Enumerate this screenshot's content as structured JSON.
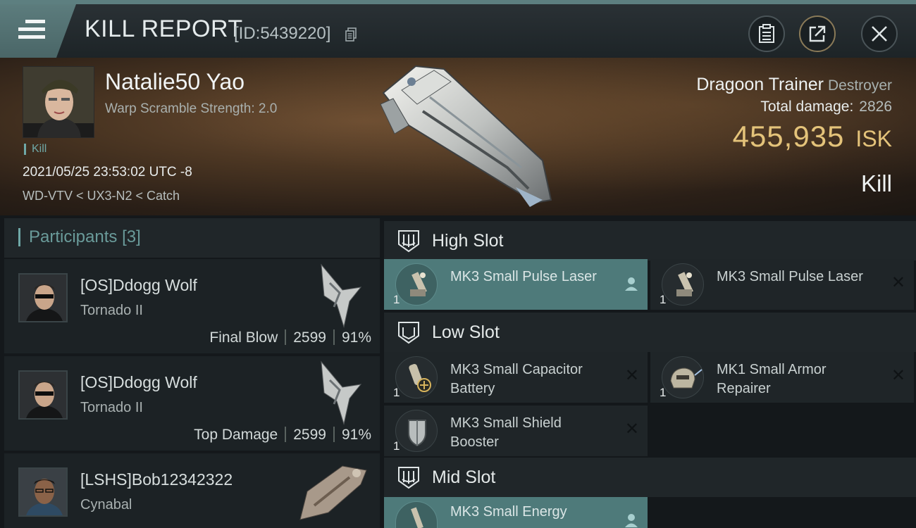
{
  "titlebar": {
    "title": "KILL REPORT",
    "id_label": "[ID:5439220]",
    "icons": [
      "menu-icon",
      "copy-icon",
      "clipboard-icon",
      "share-icon",
      "close-icon"
    ]
  },
  "victim": {
    "name": "Natalie50 Yao",
    "subtitle": "Warp Scramble Strength: 2.0",
    "tag": "Kill",
    "datetime": "2021/05/25 23:53:02 UTC -8",
    "location": "WD-VTV < UX3-N2 < Catch",
    "ship_name": "Dragoon Trainer",
    "ship_class": "Destroyer",
    "total_damage_label": "Total damage:",
    "total_damage": "2826",
    "isk_value": "455,935",
    "isk_unit": "ISK",
    "result": "Kill"
  },
  "participants": {
    "label": "Participants",
    "count": "[3]",
    "rows": [
      {
        "name": "[OS]Ddogg Wolf",
        "ship": "Tornado II",
        "role": "Final Blow",
        "damage": "2599",
        "percent": "91%"
      },
      {
        "name": "[OS]Ddogg Wolf",
        "ship": "Tornado II",
        "role": "Top Damage",
        "damage": "2599",
        "percent": "91%"
      },
      {
        "name": "[LSHS]Bob12342322",
        "ship": "Cynabal",
        "role": "",
        "damage": "",
        "percent": ""
      }
    ]
  },
  "slots": {
    "high": {
      "label": "High Slot",
      "modules": [
        {
          "name": "MK3 Small Pulse Laser",
          "qty": "1",
          "highlighted": true
        },
        {
          "name": "MK3 Small Pulse Laser",
          "qty": "1",
          "highlighted": false
        }
      ]
    },
    "low": {
      "label": "Low Slot",
      "modules": [
        {
          "name": "MK3 Small Capacitor Battery",
          "qty": "1"
        },
        {
          "name": "MK1 Small Armor Repairer",
          "qty": "1"
        },
        {
          "name": "MK3 Small Shield Booster",
          "qty": "1"
        }
      ]
    },
    "mid": {
      "label": "Mid Slot",
      "modules": [
        {
          "name": "MK3 Small Energy",
          "qty": "",
          "highlighted": true
        }
      ]
    }
  },
  "colors": {
    "accent": "#6fa8a7",
    "isk": "#e4c37a",
    "highlight_row": "#4e7a7a"
  }
}
